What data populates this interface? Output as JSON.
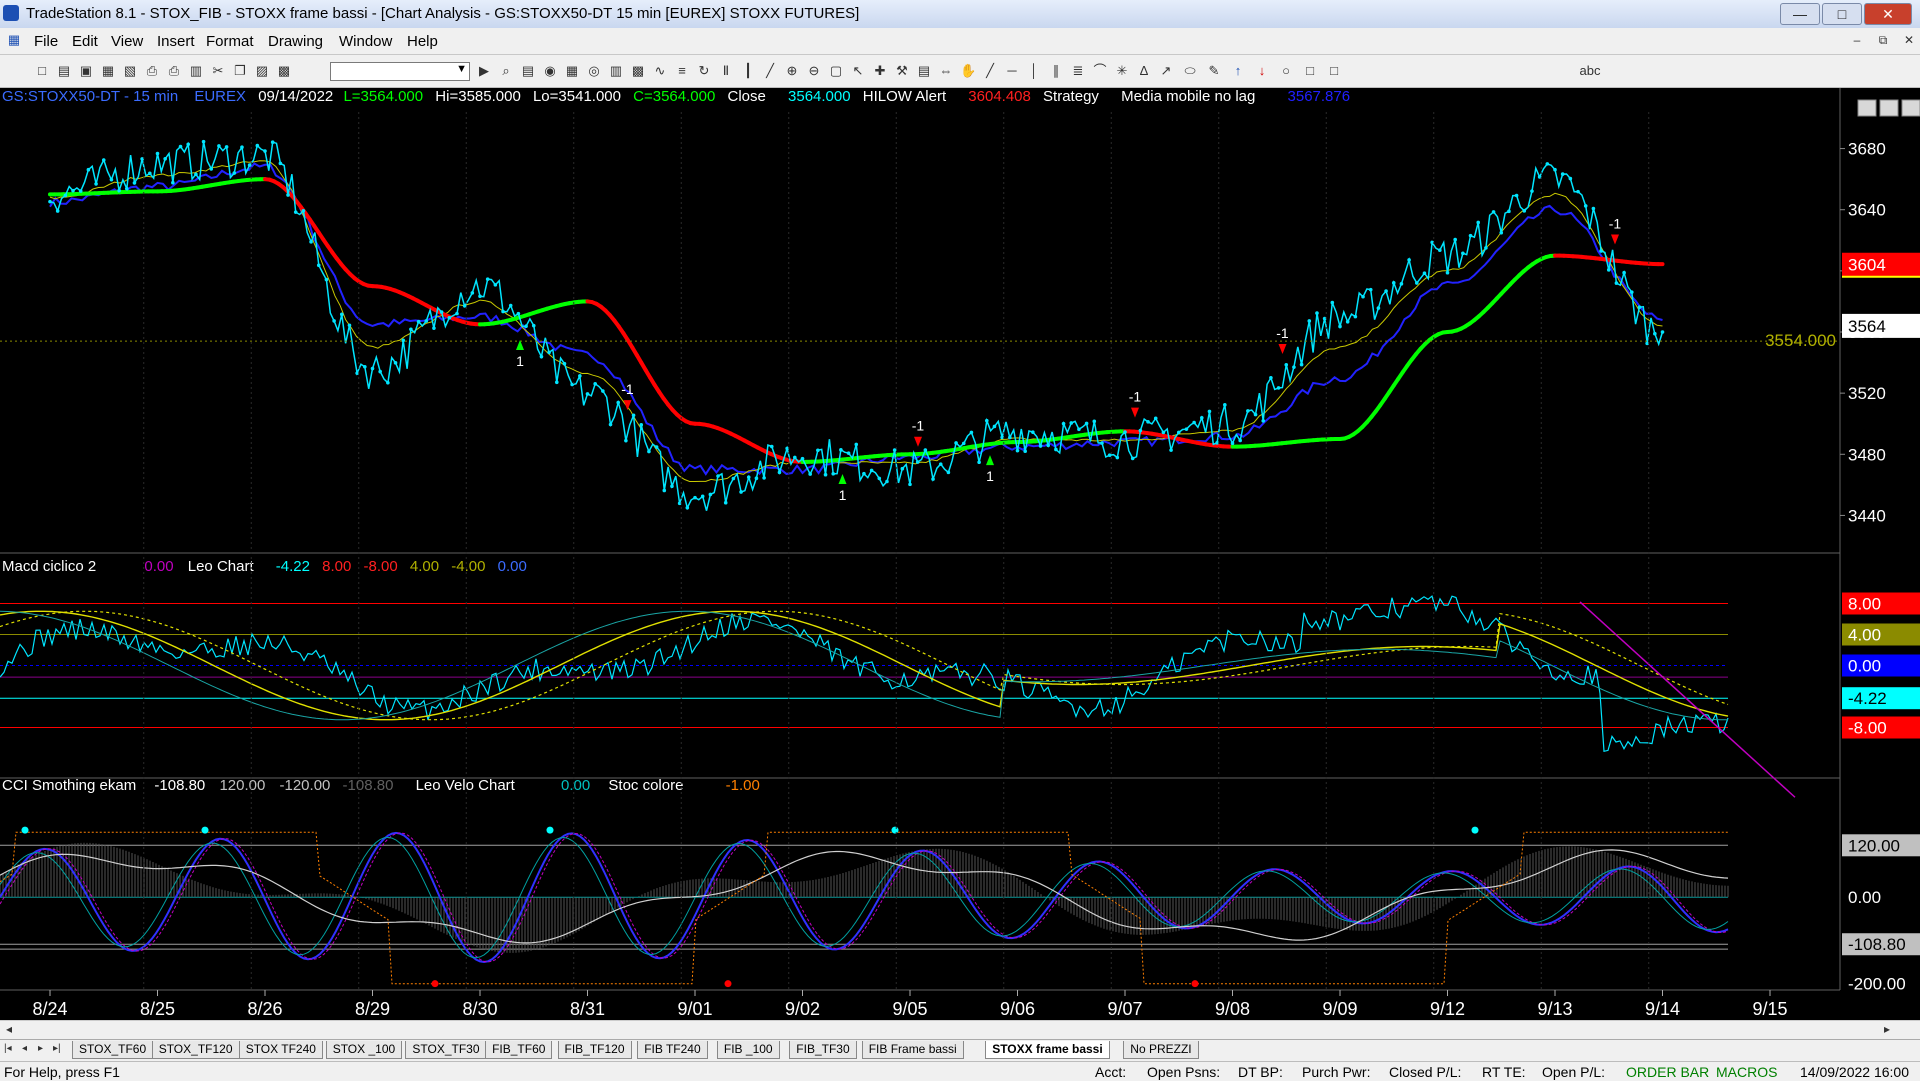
{
  "window": {
    "title": "TradeStation 8.1 - STOX_FIB - STOXX frame bassi - [Chart Analysis - GS:STOXX50-DT  15 min  [EUREX] STOXX FUTURES]",
    "minimize": "—",
    "maximize": "□",
    "close": "✕"
  },
  "menu": {
    "items": [
      "File",
      "Edit",
      "View",
      "Insert",
      "Format",
      "Drawing",
      "Window",
      "Help"
    ],
    "mdi_min": "–",
    "mdi_restore": "⧉",
    "mdi_close": "✕"
  },
  "toolbar": {
    "icons": [
      "new-doc-icon",
      "open-icon",
      "save-icon",
      "save-all-icon",
      "close-icon",
      "print-preview-icon",
      "print-icon",
      "workspace-icon",
      "cut-icon",
      "copy-icon",
      "paste-icon",
      "app-icon",
      "symbol-combo",
      "go-icon",
      "find-icon",
      "chart-icon",
      "radar-icon",
      "matrix-icon",
      "scanner-icon",
      "data-window-icon",
      "strategy-icon",
      "indicator-icon",
      "compare-icon",
      "refresh-icon",
      "bar-icon",
      "candle-icon",
      "line-icon",
      "zoom-in-icon",
      "zoom-out-icon",
      "zoom-fit-icon",
      "cursor-icon",
      "crosshair-icon",
      "tools-icon",
      "snap-icon",
      "scroll-icon",
      "hand-icon",
      "trendline-icon",
      "hline-icon",
      "vline-icon",
      "channel-icon",
      "fib-icon",
      "arc-icon",
      "gann-icon",
      "andrews-icon",
      "regression-icon",
      "ellipse-icon",
      "pen-icon",
      "up-arrow-icon",
      "down-arrow-icon",
      "circle-icon",
      "rect-icon",
      "text-icon"
    ],
    "text_tool": "abc"
  },
  "chart": {
    "header": {
      "symbol": "GS:STOXX50-DT - 15 min",
      "exchange": "EUREX",
      "date": "09/14/2022",
      "last": "L=3564.000",
      "hi": "Hi=3585.000",
      "lo": "Lo=3541.000",
      "close": "C=3564.000",
      "close_label": "Close",
      "close_value": "3564.000",
      "hilow_label": "HILOW Alert",
      "hilow_value": "3604.408",
      "strategy_label": "Strategy",
      "media_label": "Media mobile no lag",
      "media_value": "3567.876"
    },
    "price_axis": {
      "ticks": [
        "3680",
        "3640",
        "3600",
        "3560",
        "3520",
        "3480",
        "3440"
      ],
      "tick_values": [
        3680,
        3640,
        3600,
        3560,
        3520,
        3480,
        3440
      ],
      "badges": [
        {
          "label": "3604",
          "value": 3604,
          "bg": "#ff0000",
          "fg": "#ffffff"
        },
        {
          "label": "3564",
          "value": 3564,
          "bg": "#ffffff",
          "fg": "#000000"
        }
      ],
      "dotted_level": 3554,
      "dotted_label": "3554.000"
    },
    "markers": {
      "sell_label": "-1",
      "buy_label": "1"
    },
    "macd": {
      "header": {
        "name": "Macd ciclico 2",
        "v1": "0.00",
        "name2": "Leo Chart",
        "v2": "-4.22",
        "v3": "8.00",
        "v4": "-8.00",
        "v5": "4.00",
        "v6": "-4.00",
        "v7": "0.00"
      },
      "levels": [
        8,
        4,
        0,
        -4.22,
        -8
      ],
      "badges": [
        {
          "label": "8.00",
          "value": 8,
          "bg": "#ff0000",
          "fg": "#ffffff"
        },
        {
          "label": "4.00",
          "value": 4,
          "bg": "#8b8b00",
          "fg": "#ffffff"
        },
        {
          "label": "0.00",
          "value": 0,
          "bg": "#0000ff",
          "fg": "#ffffff"
        },
        {
          "label": "-4.22",
          "value": -4.22,
          "bg": "#00ffff",
          "fg": "#000000"
        },
        {
          "label": "-8.00",
          "value": -8,
          "bg": "#ff0000",
          "fg": "#ffffff"
        }
      ]
    },
    "cci": {
      "header": {
        "name": "CCI Smothing ekam",
        "v1": "-108.80",
        "v2": "120.00",
        "v3": "-120.00",
        "v4": "-108.80",
        "name2": "Leo Velo Chart",
        "v5": "0.00",
        "name3": "Stoc colore",
        "v6": "-1.00"
      },
      "badges": [
        {
          "label": "120.00",
          "value": 120,
          "bg": "#c0c0c0",
          "fg": "#000000"
        },
        {
          "label": "0.00",
          "value": 0,
          "bg": "#000000",
          "fg": "#ffffff"
        },
        {
          "label": "-108.80",
          "value": -108.8,
          "bg": "#c0c0c0",
          "fg": "#000000"
        },
        {
          "label": "-200.00",
          "value": -200,
          "bg": "#000000",
          "fg": "#ffffff"
        }
      ]
    },
    "date_axis": [
      "8/24",
      "8/25",
      "8/26",
      "8/29",
      "8/30",
      "8/31",
      "9/01",
      "9/02",
      "9/05",
      "9/06",
      "9/07",
      "9/08",
      "9/09",
      "9/12",
      "9/13",
      "9/14",
      "9/15"
    ]
  },
  "chart_data": {
    "type": "line",
    "categories": [
      "8/24",
      "8/25",
      "8/26",
      "8/29",
      "8/30",
      "8/31",
      "9/01",
      "9/02",
      "9/05",
      "9/06",
      "9/07",
      "9/08",
      "9/09",
      "9/12",
      "9/13",
      "9/14"
    ],
    "ylim": [
      3420,
      3700
    ],
    "series": [
      {
        "name": "Close",
        "values": [
          3650,
          3670,
          3675,
          3535,
          3590,
          3520,
          3455,
          3480,
          3470,
          3495,
          3490,
          3500,
          3570,
          3610,
          3660,
          3560
        ]
      },
      {
        "name": "Media mobile no lag",
        "values": [
          3645,
          3655,
          3668,
          3565,
          3570,
          3545,
          3470,
          3470,
          3478,
          3485,
          3488,
          3492,
          3530,
          3590,
          3640,
          3567.876
        ]
      },
      {
        "name": "HILOW Alert",
        "values": [
          3650,
          3652,
          3660,
          3590,
          3565,
          3580,
          3500,
          3475,
          3480,
          3488,
          3495,
          3485,
          3490,
          3560,
          3610,
          3604.408
        ]
      }
    ],
    "signals": [
      {
        "date": "8/30",
        "label": "1",
        "type": "buy"
      },
      {
        "date": "8/31",
        "label": "-1",
        "type": "sell"
      },
      {
        "date": "9/02",
        "label": "1",
        "type": "buy"
      },
      {
        "date": "9/05",
        "label": "-1",
        "type": "sell"
      },
      {
        "date": "9/05",
        "label": "1",
        "type": "buy"
      },
      {
        "date": "9/07",
        "label": "-1",
        "type": "sell"
      },
      {
        "date": "9/08",
        "label": "-1",
        "type": "sell"
      },
      {
        "date": "9/13",
        "label": "-1",
        "type": "sell"
      }
    ]
  },
  "scrollbar": {
    "left": "◂",
    "right": "▸"
  },
  "tabs": {
    "nav": [
      "|◂",
      "◂",
      "▸",
      "▸|"
    ],
    "items": [
      "STOX_TF60",
      "STOX_TF120",
      "STOX TF240",
      "STOX _100",
      "STOX_TF30",
      "FIB_TF60",
      "FIB_TF120",
      "FIB TF240",
      "FIB _100",
      "FIB_TF30",
      "FIB Frame bassi",
      "STOXX frame bassi",
      "No PREZZI"
    ],
    "active": 11
  },
  "status": {
    "help": "For Help, press F1",
    "acct": "Acct:",
    "open_psns": "Open Psns:",
    "dt_bp": "DT BP:",
    "purch_pwr": "Purch Pwr:",
    "closed_pl": "Closed P/L:",
    "rt_te": "RT TE:",
    "open_pl": "Open P/L:",
    "order_bar": "ORDER BAR",
    "macros": "MACROS",
    "datetime": "14/09/2022 16:00"
  }
}
